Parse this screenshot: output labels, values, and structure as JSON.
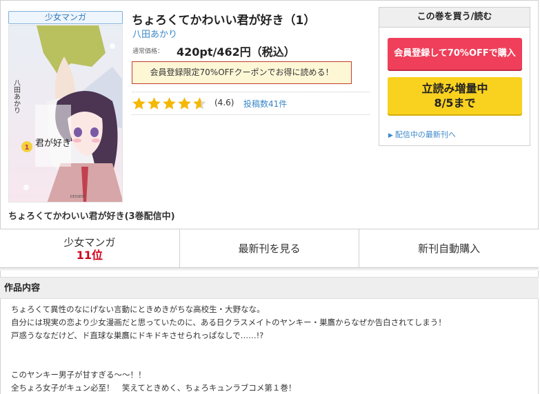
{
  "genre_badge": "少女マンガ",
  "cover": {
    "author_vertical": "八田あかり",
    "logo_text": "君が好き",
    "volume": "1",
    "publisher_mark": "DESSERT"
  },
  "series_title": "ちょろくてかわいい君が好き(3巻配信中)",
  "book": {
    "title": "ちょろくてかわいい君が好き（1）",
    "author": "八田あかり",
    "price_label": "通常価格：",
    "price": "420pt/462円（税込）",
    "coupon": "会員登録限定70%OFFクーポンでお得に読める！",
    "rating": 4.6,
    "rating_text": "(4.6)",
    "review_count": "投稿数41件"
  },
  "buy_panel": {
    "header": "この巻を買う/読む",
    "member_button": "会員登録して70%OFFで購入",
    "preview_line1": "立読み増量中",
    "preview_line2": "8/5まで",
    "newest_link": "配信中の最新刊へ"
  },
  "tabs": {
    "ranking_label": "少女マンガ",
    "ranking_value": "11位",
    "latest": "最新刊を見る",
    "auto_buy": "新刊自動購入"
  },
  "description": {
    "header": "作品内容",
    "lines1": [
      "ちょろくて異性のなにげない言動にときめきがちな高校生・大野なな。",
      "自分には現実の恋より少女漫画だと思っていたのに、ある日クラスメイトのヤンキー・巣鷹からなぜか告白されてしまう！",
      "戸惑うななだけど、ド直球な巣鷹にドキドキさせられっぱなしで……!?"
    ],
    "lines2": [
      "このヤンキー男子が甘すぎる～～！！",
      "全ちょろ女子がキュン必至！　笑えてときめく、ちょろキュンラブコメ第１巻！"
    ]
  },
  "colors": {
    "link": "#3a87c8",
    "member_button": "#ef3f5a",
    "preview_button": "#f9d11f",
    "rank": "#d0021b",
    "coupon_border": "#c43b2b",
    "star": "#f5b800"
  }
}
